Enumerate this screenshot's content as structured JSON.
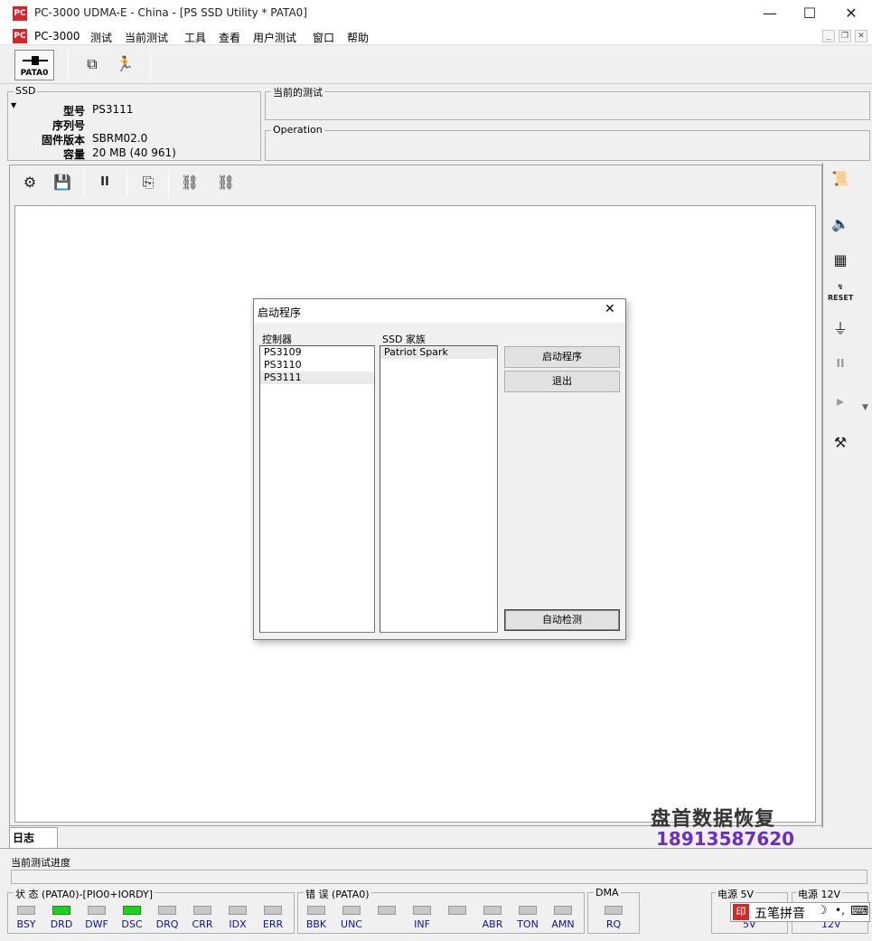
{
  "window": {
    "title": "PC-3000 UDMA-E - China - [PS SSD Utility * PATA0]",
    "app_icon": "PC",
    "minimize": "—",
    "maximize": "☐",
    "close": "✕"
  },
  "menu": {
    "items": [
      "PC-3000",
      "测试",
      "当前测试",
      "工具",
      "查看",
      "用户测试",
      "窗口",
      "帮助"
    ]
  },
  "toolbar": {
    "pata_label": "PATA0"
  },
  "ssd_info": {
    "group_label": "SSD",
    "model_label": "型号",
    "model_value": "PS3111",
    "serial_label": "序列号",
    "serial_value": "",
    "firmware_label": "固件版本",
    "firmware_value": "SBRM02.0",
    "capacity_label": "容量",
    "capacity_value": "20 MB (40 961)"
  },
  "current_test": {
    "label": "当前的测试",
    "operation_label": "Operation"
  },
  "dialog": {
    "title": "启动程序",
    "controller_label": "控制器",
    "controllers": [
      "PS3109",
      "PS3110",
      "PS3111"
    ],
    "family_label": "SSD 家族",
    "families": [
      "Patriot Spark"
    ],
    "start_button": "启动程序",
    "exit_button": "退出",
    "autodetect_button": "自动检测"
  },
  "log": {
    "tab_label": "日志",
    "progress_label": "当前测试进度"
  },
  "status": {
    "state_label": "状 态 (PATA0)-[PIO0+IORDY]",
    "state_leds": [
      {
        "label": "BSY",
        "on": false
      },
      {
        "label": "DRD",
        "on": true
      },
      {
        "label": "DWF",
        "on": false
      },
      {
        "label": "DSC",
        "on": true
      },
      {
        "label": "DRQ",
        "on": false
      },
      {
        "label": "CRR",
        "on": false
      },
      {
        "label": "IDX",
        "on": false
      },
      {
        "label": "ERR",
        "on": false
      }
    ],
    "error_label": "错 误 (PATA0)",
    "error_leds": [
      "BBK",
      "UNC",
      "",
      "INF",
      "",
      "ABR",
      "TON",
      "AMN"
    ],
    "dma_label": "DMA",
    "dma_led": "RQ",
    "power5_label": "电源 5V",
    "power5_value": "5V",
    "power12_label": "电源 12V",
    "power12_value": "12V"
  },
  "ime": {
    "text": "五笔拼音"
  },
  "watermark": {
    "line1": "盘首数据恢复",
    "line2": "18913587620"
  }
}
